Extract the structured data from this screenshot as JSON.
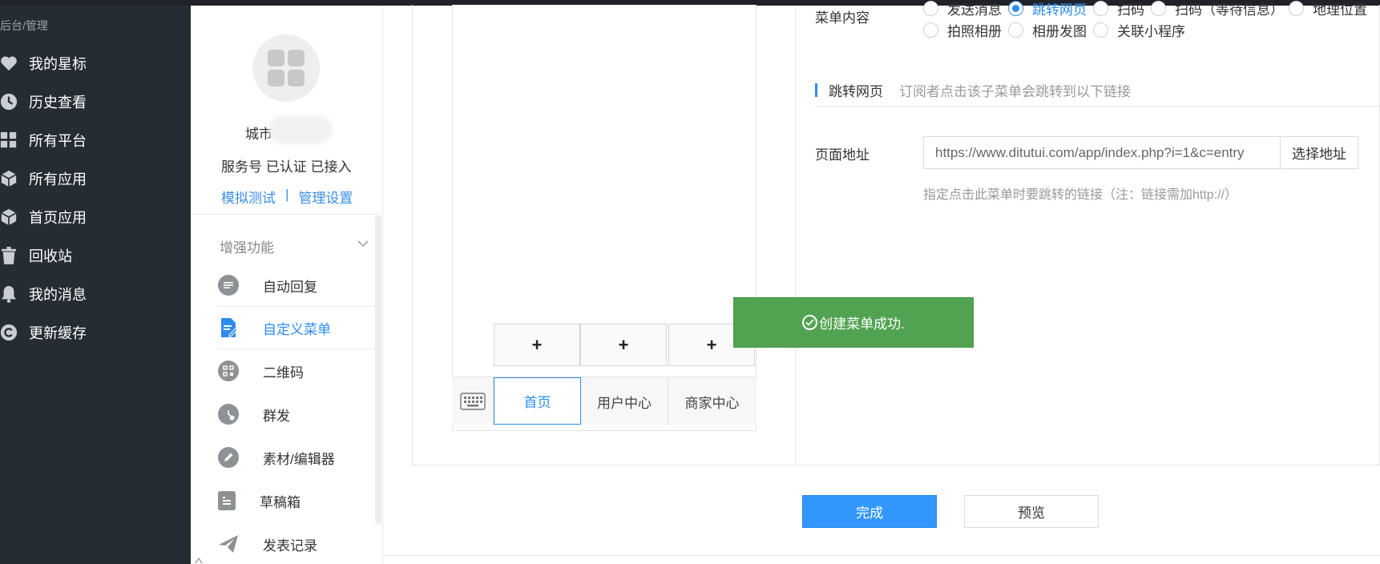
{
  "sidebar": {
    "breadcrumb": "后台/管理",
    "items": [
      {
        "label": "我的星标",
        "icon": "heart-icon"
      },
      {
        "label": "历史查看",
        "icon": "clock-icon"
      },
      {
        "label": "所有平台",
        "icon": "grid-icon"
      },
      {
        "label": "所有应用",
        "icon": "cube-icon"
      },
      {
        "label": "首页应用",
        "icon": "cube-icon"
      },
      {
        "label": "回收站",
        "icon": "trash-icon"
      },
      {
        "label": "我的消息",
        "icon": "bell-icon"
      },
      {
        "label": "更新缓存",
        "icon": "refresh-icon"
      }
    ]
  },
  "account": {
    "name": "城市",
    "status": "服务号 已认证 已接入",
    "link_test": "模拟测试",
    "link_sep": "|",
    "link_manage": "管理设置"
  },
  "features": {
    "title": "增强功能",
    "items": [
      {
        "label": "自动回复",
        "icon": "chat-icon",
        "active": false
      },
      {
        "label": "自定义菜单",
        "icon": "document-edit-icon",
        "active": true
      },
      {
        "label": "二维码",
        "icon": "qrcode-icon",
        "active": false
      },
      {
        "label": "群发",
        "icon": "clock-broadcast-icon",
        "active": false
      },
      {
        "label": "素材/编辑器",
        "icon": "pencil-icon",
        "active": false
      },
      {
        "label": "草稿箱",
        "icon": "draft-icon",
        "active": false
      },
      {
        "label": "发表记录",
        "icon": "send-icon",
        "active": false
      }
    ]
  },
  "phone": {
    "plus": "+",
    "tabs": [
      "首页",
      "用户中心",
      "商家中心"
    ],
    "active_tab": 0
  },
  "toast": {
    "message": "创建菜单成功."
  },
  "config": {
    "content_label": "菜单内容",
    "options_row1": [
      "发送消息",
      "跳转网页",
      "扫码",
      "扫码（等待信息）",
      "地理位置"
    ],
    "options_row2": [
      "拍照相册",
      "相册发图",
      "关联小程序"
    ],
    "selected": "跳转网页",
    "section_title": "跳转网页",
    "section_desc": "订阅者点击该子菜单会跳转到以下链接",
    "url_label": "页面地址",
    "url_value": "https://www.ditutui.com/app/index.php?i=1&c=entry",
    "url_button": "选择地址",
    "url_hint": "指定点击此菜单时要跳转的链接（注：链接需加http://）"
  },
  "actions": {
    "done": "完成",
    "preview": "预览"
  },
  "colors": {
    "accent": "#2d8cf0",
    "toast": "#51a351",
    "sidebar_bg": "#262c34"
  }
}
